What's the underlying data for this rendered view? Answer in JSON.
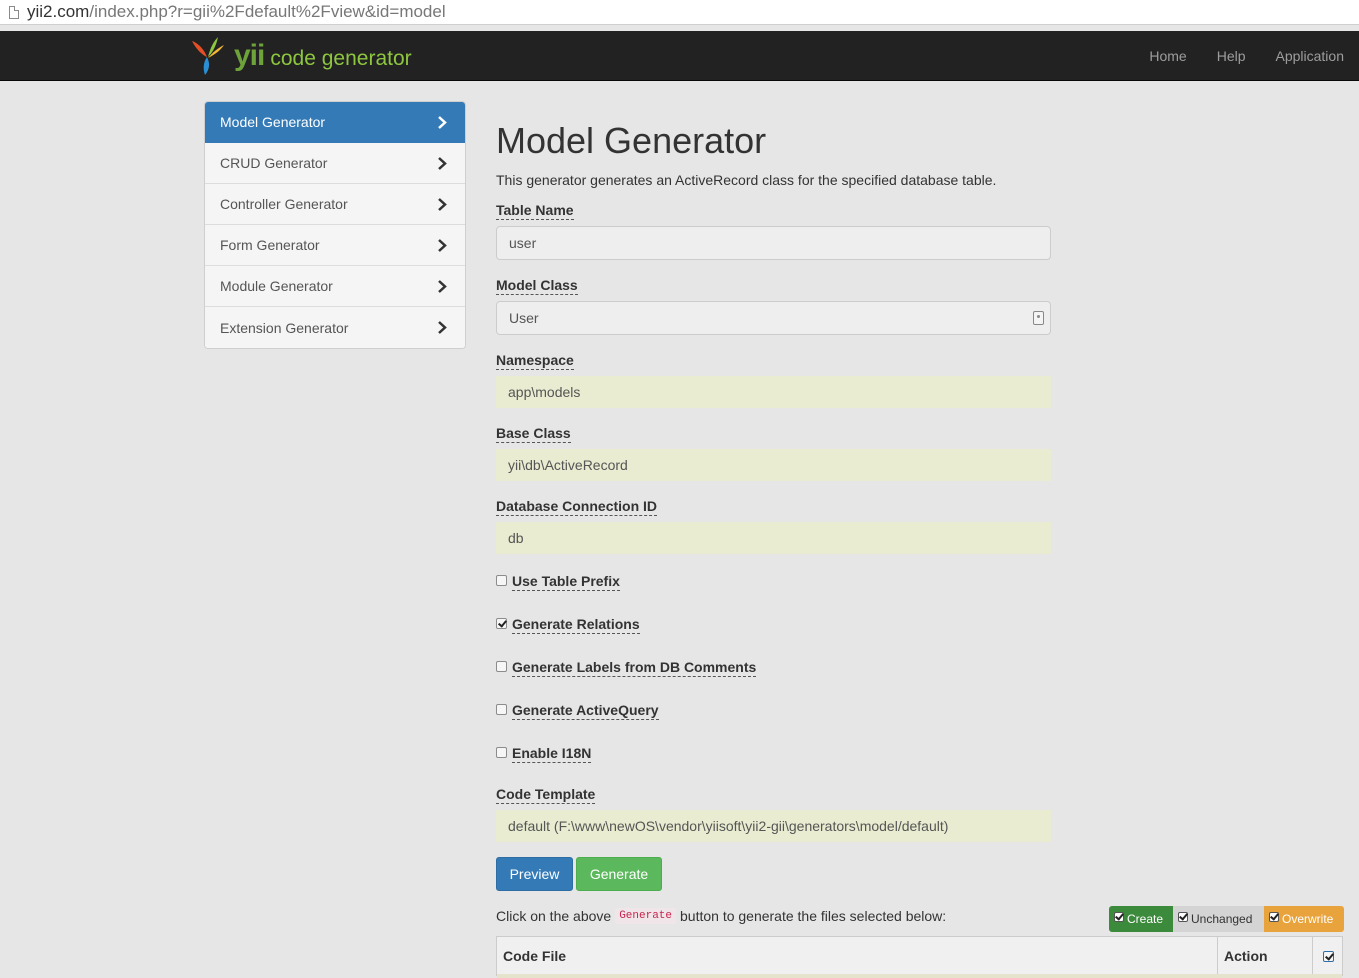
{
  "browser": {
    "url_host": "yii2.com",
    "url_path": "/index.php?r=gii%2Fdefault%2Fview&id=model"
  },
  "navbar": {
    "brand_name": "yii",
    "brand_sub": "code generator",
    "links": [
      "Home",
      "Help",
      "Application"
    ]
  },
  "sidebar": {
    "items": [
      {
        "label": "Model Generator",
        "active": true
      },
      {
        "label": "CRUD Generator"
      },
      {
        "label": "Controller Generator"
      },
      {
        "label": "Form Generator"
      },
      {
        "label": "Module Generator"
      },
      {
        "label": "Extension Generator"
      }
    ]
  },
  "main": {
    "title": "Model Generator",
    "description": "This generator generates an ActiveRecord class for the specified database table.",
    "fields": {
      "table_name": {
        "label": "Table Name",
        "value": "user"
      },
      "model_class": {
        "label": "Model Class",
        "value": "User"
      },
      "namespace": {
        "label": "Namespace",
        "value": "app\\models"
      },
      "base_class": {
        "label": "Base Class",
        "value": "yii\\db\\ActiveRecord"
      },
      "db_connection": {
        "label": "Database Connection ID",
        "value": "db"
      },
      "code_template": {
        "label": "Code Template",
        "value": "default (F:\\www\\newOS\\vendor\\yiisoft\\yii2-gii\\generators\\model/default)"
      }
    },
    "checkboxes": [
      {
        "label": "Use Table Prefix",
        "checked": false
      },
      {
        "label": "Generate Relations",
        "checked": true
      },
      {
        "label": "Generate Labels from DB Comments",
        "checked": false
      },
      {
        "label": "Generate ActiveQuery",
        "checked": false
      },
      {
        "label": "Enable I18N",
        "checked": false
      }
    ],
    "buttons": {
      "preview": "Preview",
      "generate": "Generate"
    },
    "hint": {
      "before": "Click on the above",
      "code": "Generate",
      "after": "button to generate the files selected below:"
    },
    "legend": {
      "create": "Create",
      "unchanged": "Unchanged",
      "overwrite": "Overwrite"
    },
    "table": {
      "col_file": "Code File",
      "col_action": "Action"
    }
  },
  "colors": {
    "navbar_bg": "#222222",
    "primary": "#337ab7",
    "success": "#5cb85c",
    "sticky_input_bg": "#e9ecd0",
    "overwrite": "#e8a33d"
  }
}
